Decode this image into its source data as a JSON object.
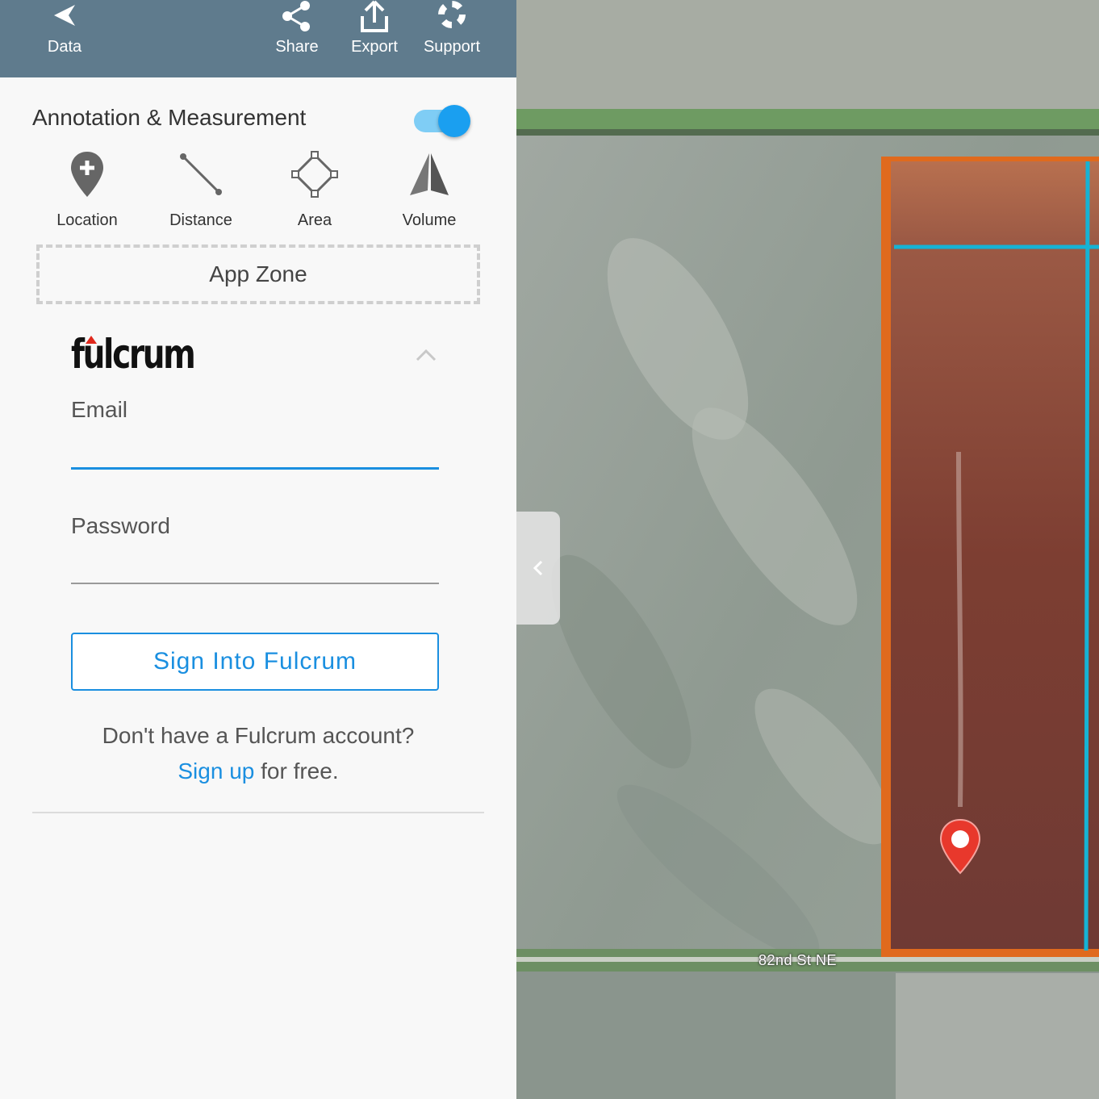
{
  "topbar": {
    "back_label": "Data",
    "share_label": "Share",
    "export_label": "Export",
    "support_label": "Support",
    "background": "#5f7b8d"
  },
  "annotation": {
    "title": "Annotation & Measurement",
    "toggle_on": true,
    "tools": [
      {
        "label": "Location",
        "icon": "location-pin-icon"
      },
      {
        "label": "Distance",
        "icon": "distance-line-icon"
      },
      {
        "label": "Area",
        "icon": "area-polygon-icon"
      },
      {
        "label": "Volume",
        "icon": "volume-pyramid-icon"
      }
    ]
  },
  "app_zone": {
    "label": "App Zone"
  },
  "fulcrum": {
    "logo_text": "fulcrum",
    "email_label": "Email",
    "password_label": "Password",
    "signin_label": "Sign Into Fulcrum",
    "no_account_text": "Don't have a Fulcrum account?",
    "signup_link": "Sign up",
    "signup_suffix": " for free."
  },
  "map": {
    "road_label": "82nd St NE",
    "colors": {
      "field_highlight": "#b5532e",
      "boundary": "#ff6a00",
      "line": "#16b3d4",
      "marker": "#e8382c"
    }
  },
  "colors": {
    "accent": "#1a8fe0",
    "toggle": "#1a9ff0"
  }
}
